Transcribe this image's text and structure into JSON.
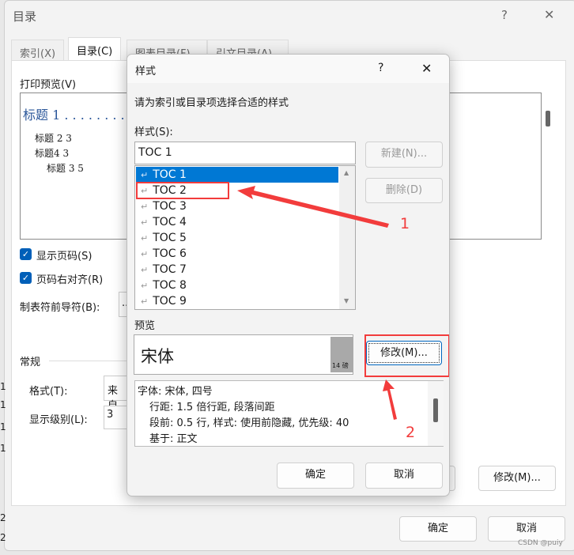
{
  "back": {
    "title": "目录",
    "help": "?",
    "close": "✕",
    "tabs": [
      "索引(X)",
      "目录(C)",
      "图表目录(F)",
      "引文目录(A)"
    ],
    "preview_label": "打印预览(V)",
    "preview_lines": [
      "标题 1 . . . . . . . .",
      "标题 2 3",
      "标题4 3",
      "标题 3 5"
    ],
    "show_page_numbers": "显示页码(S)",
    "right_align": "页码右对齐(R)",
    "tab_leader": "制表符前导符(B):",
    "tab_leader_value": "..",
    "general": "常规",
    "format_label": "格式(T):",
    "format_value": "来自",
    "levels_label": "显示级别(L):",
    "levels_value": "3",
    "modify": "修改(M)...",
    "ok": "确定",
    "cancel": "取消",
    "edge_digits": [
      "1",
      "1",
      "1",
      "1",
      "2",
      "2"
    ]
  },
  "style": {
    "title": "样式",
    "help": "?",
    "close": "✕",
    "instruction": "请为索引或目录项选择合适的样式",
    "styles_label": "样式(S):",
    "style_value": "TOC 1",
    "items": [
      "TOC 1",
      "TOC 2",
      "TOC 3",
      "TOC 4",
      "TOC 5",
      "TOC 6",
      "TOC 7",
      "TOC 8",
      "TOC 9"
    ],
    "selected_index": 0,
    "new": "新建(N)...",
    "delete": "删除(D)",
    "preview_label": "预览",
    "preview_font": "宋体",
    "preview_size": "14 磅",
    "modify": "修改(M)...",
    "desc": [
      "字体: 宋体, 四号",
      "行距: 1.5 倍行距, 段落间距",
      "段前: 0.5 行, 样式: 使用前隐藏, 优先级: 40",
      "基于: 正文"
    ],
    "ok": "确定",
    "cancel": "取消"
  },
  "annotations": {
    "one": "1",
    "two": "2",
    "color": "#f23c3c"
  },
  "watermark": "CSDN @puiy"
}
